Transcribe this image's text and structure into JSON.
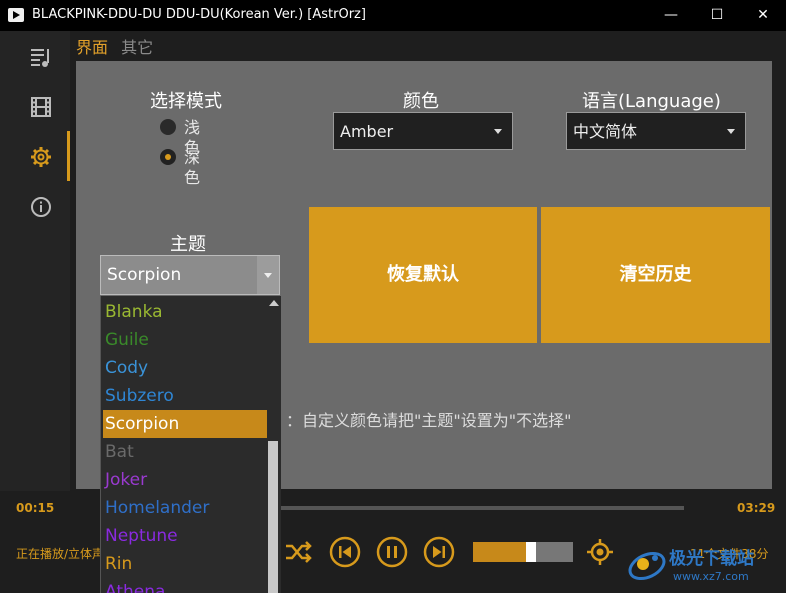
{
  "window": {
    "title": "BLACKPINK-DDU-DU DDU-DU(Korean Ver.) [AstrOrz]",
    "minimize": "—",
    "maximize": "☐",
    "close": "✕"
  },
  "sidebar": {
    "items": [
      {
        "name": "playlist-icon"
      },
      {
        "name": "video-icon"
      },
      {
        "name": "gear-icon",
        "active": true
      },
      {
        "name": "info-icon"
      }
    ]
  },
  "tabs": [
    {
      "label": "界面",
      "active": true
    },
    {
      "label": "其它",
      "active": false
    }
  ],
  "settings": {
    "mode_label": "选择模式",
    "mode_options": [
      {
        "label": "浅色",
        "checked": false
      },
      {
        "label": "深色",
        "checked": true
      }
    ],
    "color_label": "颜色",
    "color_value": "Amber",
    "language_label": "语言(Language)",
    "language_value": "中文简体",
    "theme_label": "主题",
    "theme_value": "Scorpion",
    "reset_button": "恢复默认",
    "clear_history_button": "清空历史",
    "hint": "：自定义颜色请把\"主题\"设置为\"不选择\""
  },
  "theme_dropdown": {
    "items": [
      {
        "label": "Blanka",
        "color": "#9ab832"
      },
      {
        "label": "Guile",
        "color": "#3a8a2a"
      },
      {
        "label": "Cody",
        "color": "#3a93d8"
      },
      {
        "label": "Subzero",
        "color": "#2f86d4"
      },
      {
        "label": "Scorpion",
        "color": "#ffffff",
        "selected": true
      },
      {
        "label": "Bat",
        "color": "#6a6a6a"
      },
      {
        "label": "Joker",
        "color": "#9a3ad0"
      },
      {
        "label": "Homelander",
        "color": "#2f6fc8"
      },
      {
        "label": "Neptune",
        "color": "#8a2ae0"
      },
      {
        "label": "Rin",
        "color": "#d79a1c"
      },
      {
        "label": "Athena",
        "color": "#8a2ae0"
      }
    ]
  },
  "player": {
    "elapsed": "00:15",
    "total": "03:29",
    "status": "正在播放/立体声",
    "files": "11个文件38分",
    "volume_fraction": 0.75,
    "accent": "#d79a1c"
  },
  "watermark": {
    "line1": "极光下载站",
    "line2": "www.xz7.com"
  }
}
